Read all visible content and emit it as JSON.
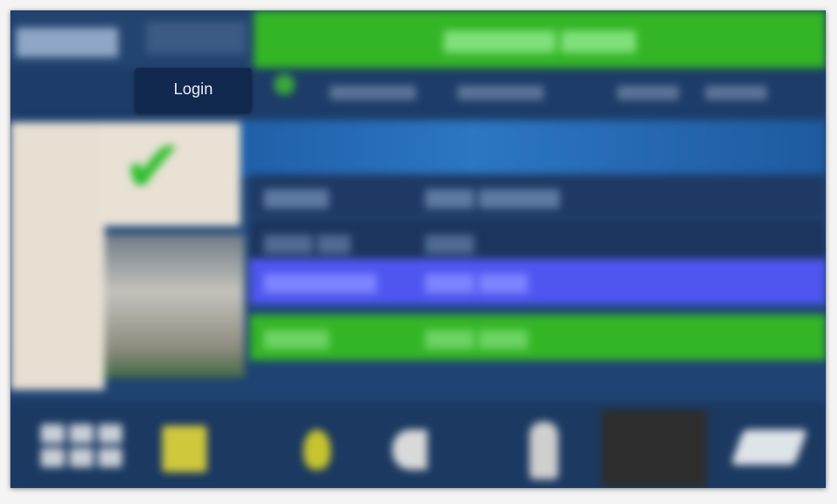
{
  "login": {
    "label": "Login"
  },
  "colors": {
    "status_green": "#34b526",
    "highlight_blue": "#4f56f0",
    "panel_navy": "#1d3c68",
    "login_bg": "#11284f"
  },
  "icons": [
    "check-icon",
    "grid-icon",
    "yellow-square-icon",
    "bulb-icon",
    "speaker-icon",
    "person-icon",
    "dark-panel-icon",
    "pencil-icon"
  ]
}
